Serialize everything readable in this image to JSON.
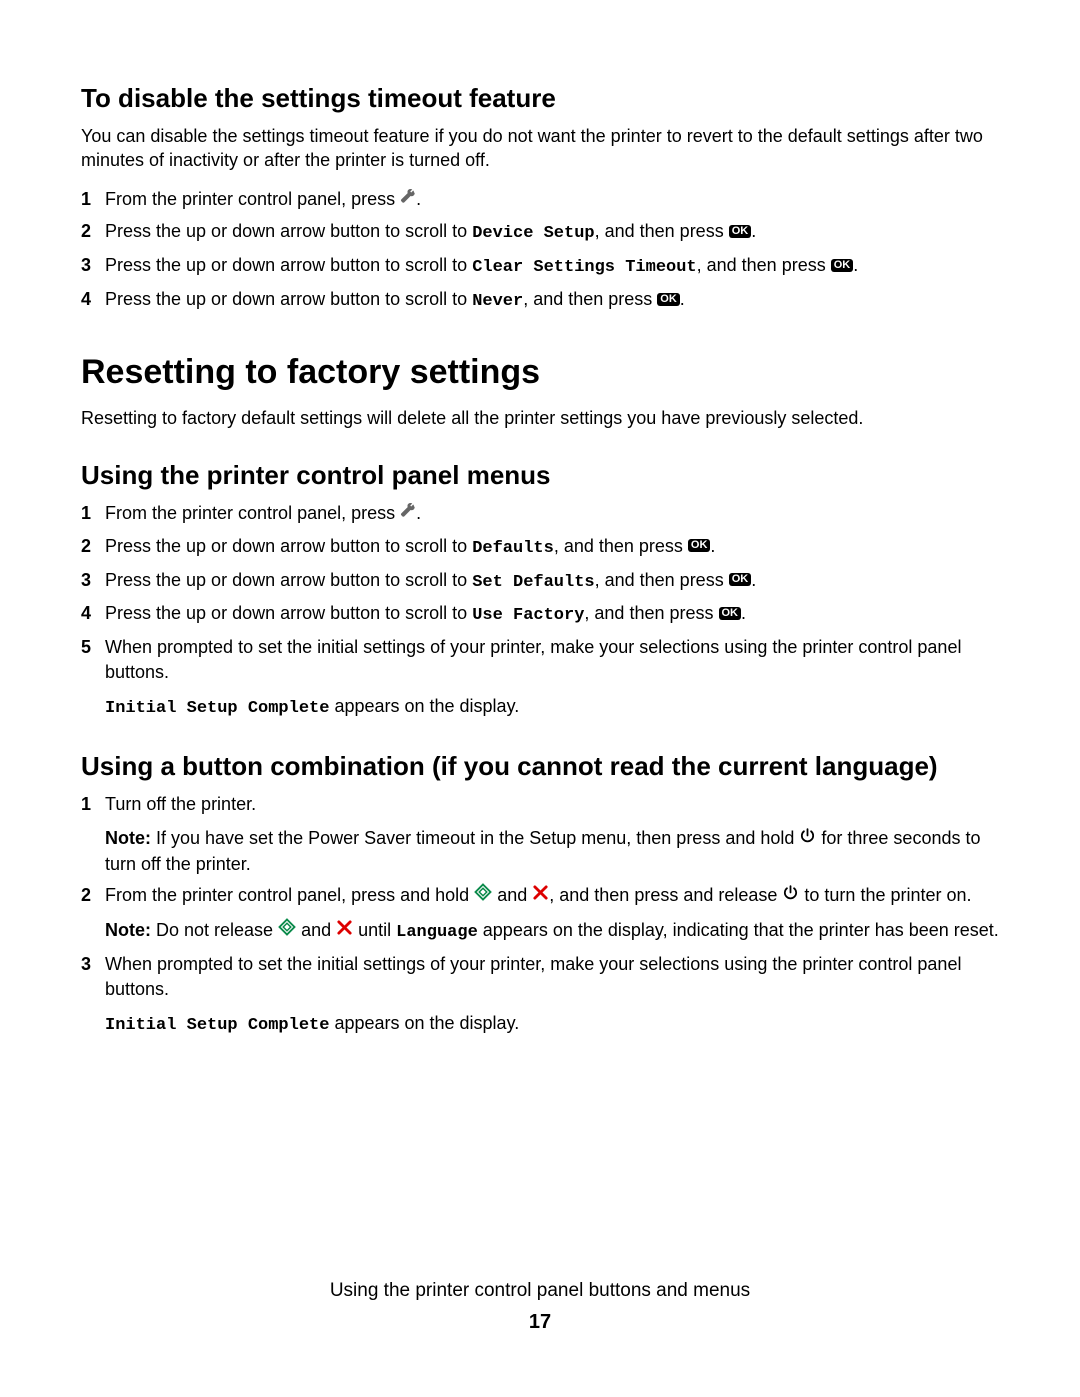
{
  "section1": {
    "heading": "To disable the settings timeout feature",
    "intro": "You can disable the settings timeout feature if you do not want the printer to revert to the default settings after two minutes of inactivity or after the printer is turned off.",
    "steps": {
      "s1_a": "From the printer control panel, press ",
      "s2_a": "Press the up or down arrow button to scroll to ",
      "s2_code": "Device Setup",
      "s2_b": ", and then press ",
      "s3_a": "Press the up or down arrow button to scroll to ",
      "s3_code": "Clear Settings Timeout",
      "s3_b": ", and then press ",
      "s4_a": "Press the up or down arrow button to scroll to ",
      "s4_code": "Never",
      "s4_b": ", and then press "
    }
  },
  "section2": {
    "heading": "Resetting to factory settings",
    "intro": "Resetting to factory default settings will delete all the printer settings you have previously selected."
  },
  "section3": {
    "heading": "Using the printer control panel menus",
    "steps": {
      "s1_a": "From the printer control panel, press ",
      "s2_a": "Press the up or down arrow button to scroll to ",
      "s2_code": "Defaults",
      "s2_b": ", and then press ",
      "s3_a": "Press the up or down arrow button to scroll to ",
      "s3_code": "Set Defaults",
      "s3_b": ", and then press ",
      "s4_a": "Press the up or down arrow button to scroll to ",
      "s4_code": "Use Factory",
      "s4_b": ", and then press ",
      "s5": "When prompted to set the initial settings of your printer, make your selections using the printer control panel buttons.",
      "s5_code": "Initial Setup Complete",
      "s5_tail": " appears on the display."
    }
  },
  "section4": {
    "heading": "Using a button combination (if you cannot read the current language)",
    "steps": {
      "s1": "Turn off the printer.",
      "s1_note_label": "Note:",
      "s1_note_a": " If you have set the Power Saver timeout in the Setup menu, then press and hold ",
      "s1_note_b": " for three seconds to turn off the printer.",
      "s2_a": "From the printer control panel, press and hold ",
      "s2_b": " and ",
      "s2_c": ", and then press and release ",
      "s2_d": " to turn the printer on.",
      "s2_note_label": "Note:",
      "s2_note_a": " Do not release ",
      "s2_note_b": " and ",
      "s2_note_c": " until ",
      "s2_note_code": "Language",
      "s2_note_d": " appears on the display, indicating that the printer has been reset.",
      "s3": "When prompted to set the initial settings of your printer, make your selections using the printer control panel buttons.",
      "s3_code": "Initial Setup Complete",
      "s3_tail": " appears on the display."
    }
  },
  "footer": {
    "title": "Using the printer control panel buttons and menus",
    "page": "17"
  },
  "labels": {
    "ok": "OK",
    "period": "."
  }
}
